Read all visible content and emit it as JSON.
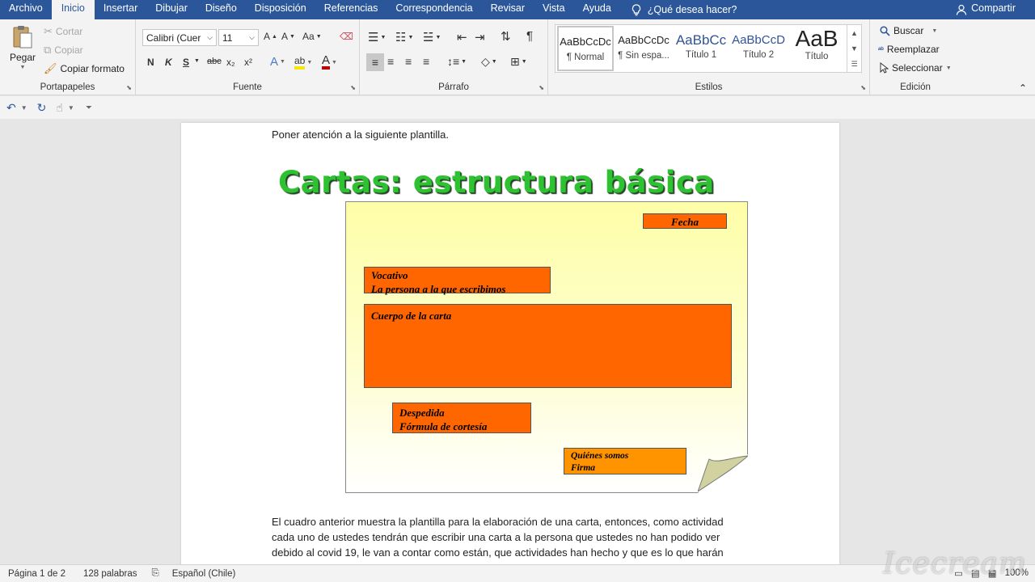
{
  "menu": {
    "tabs": [
      "Archivo",
      "Inicio",
      "Insertar",
      "Dibujar",
      "Diseño",
      "Disposición",
      "Referencias",
      "Correspondencia",
      "Revisar",
      "Vista",
      "Ayuda"
    ],
    "tell_me": "¿Qué desea hacer?",
    "share": "Compartir"
  },
  "ribbon": {
    "clipboard": {
      "paste": "Pegar",
      "cut": "Cortar",
      "copy": "Copiar",
      "format_painter": "Copiar formato",
      "label": "Portapapeles"
    },
    "font": {
      "family": "Calibri (Cuer",
      "size": "11",
      "change_case": "Aa",
      "label": "Fuente",
      "bold": "N",
      "italic": "K",
      "underline": "S",
      "strike": "abc",
      "sub": "x₂",
      "sup": "x²"
    },
    "paragraph": {
      "label": "Párrafo"
    },
    "styles": {
      "items": [
        {
          "preview": "AaBbCcDc",
          "name": "¶ Normal"
        },
        {
          "preview": "AaBbCcDc",
          "name": "¶ Sin espa..."
        },
        {
          "preview": "AaBbCc",
          "name": "Título 1"
        },
        {
          "preview": "AaBbCcD",
          "name": "Título 2"
        },
        {
          "preview": "AaB",
          "name": "Título"
        }
      ],
      "label": "Estilos"
    },
    "editing": {
      "find": "Buscar",
      "replace": "Reemplazar",
      "select": "Seleccionar",
      "label": "Edición"
    }
  },
  "document": {
    "intro": "Poner atención a la siguiente plantilla.",
    "graphic": {
      "title": "Cartas: estructura básica",
      "fecha": "Fecha",
      "vocativo_1": "Vocativo",
      "vocativo_2": "La persona a la que escribimos",
      "cuerpo": "Cuerpo de la carta",
      "despedida_1": "Despedida",
      "despedida_2": "Fórmula de cortesía",
      "firma_1": "Quiénes somos",
      "firma_2": "Firma"
    },
    "body_lines": [
      "El cuadro anterior muestra la plantilla para la elaboración de una carta, entonces, como actividad",
      "cada uno de ustedes tendrán que escribir una carta a la persona que ustedes no han podido ver",
      "debido al covid 19, le van a contar como están, que actividades han hecho y que es lo que harán"
    ]
  },
  "status": {
    "page": "Página 1 de 2",
    "words": "128 palabras",
    "language": "Español (Chile)",
    "zoom": "100%"
  },
  "watermark": "Icecream",
  "colors": {
    "word_blue": "#2b579a",
    "orange": "#ff6600",
    "title_green": "#2ec232"
  }
}
